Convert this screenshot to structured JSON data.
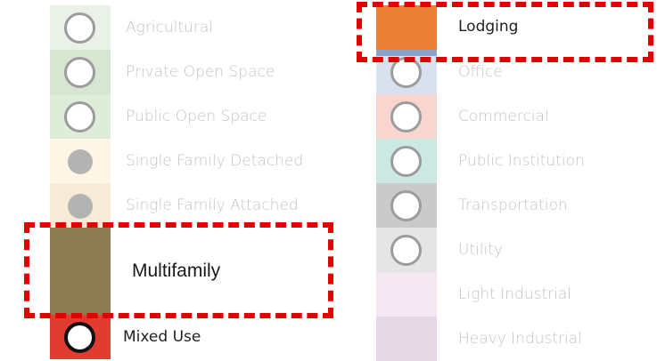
{
  "legend": {
    "left_column": [
      {
        "label": "Agricultural",
        "color": "#eaf2e8",
        "marker": "open"
      },
      {
        "label": "Private Open Space",
        "color": "#d6e6d2",
        "marker": "open"
      },
      {
        "label": "Public Open Space",
        "color": "#deedd9",
        "marker": "open"
      },
      {
        "label": "Single Family Detached",
        "color": "#fdf5e6",
        "marker": "filled"
      },
      {
        "label": "Single Family Attached",
        "color": "#f7ead6",
        "marker": "filled"
      },
      {
        "label": "Multifamily",
        "color": "#8e7d52",
        "marker": "none"
      },
      {
        "label": "Mixed Use",
        "color": "#e03c2f",
        "marker": "strong"
      }
    ],
    "right_column": [
      {
        "label": "Lodging",
        "color": "#ea7f36",
        "marker": "none"
      },
      {
        "label": "Office",
        "color": "#d9e0ee",
        "marker": "open"
      },
      {
        "label": "Commercial",
        "color": "#f8d5cf",
        "marker": "open"
      },
      {
        "label": "Public Institution",
        "color": "#cbe9e2",
        "marker": "open"
      },
      {
        "label": "Transportation",
        "color": "#cacaca",
        "marker": "open"
      },
      {
        "label": "Utility",
        "color": "#e5e5e5",
        "marker": "open"
      },
      {
        "label": "Light Industrial",
        "color": "#f3e8f1",
        "marker": "none"
      },
      {
        "label": "Heavy Industrial",
        "color": "#e6d7e4",
        "marker": "none"
      }
    ]
  },
  "highlight_color": "#e10000"
}
